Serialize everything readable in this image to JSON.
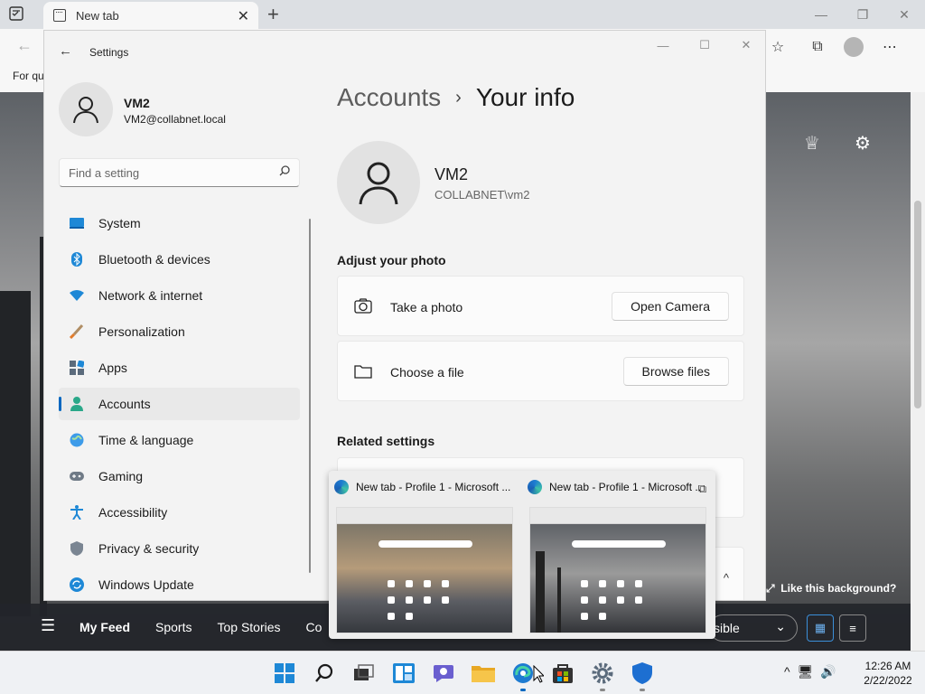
{
  "browser": {
    "tab_title": "New tab",
    "favbar_text": "For qu",
    "page": {
      "feed_items": [
        "My Feed",
        "Sports",
        "Top Stories",
        "Co"
      ],
      "visible_label": "sible",
      "like_background": "Like this background?"
    }
  },
  "settings": {
    "window_title": "Settings",
    "user": {
      "name": "VM2",
      "email": "VM2@collabnet.local"
    },
    "search_placeholder": "Find a setting",
    "nav": [
      {
        "label": "System",
        "icon": "system-icon"
      },
      {
        "label": "Bluetooth & devices",
        "icon": "bluetooth-icon"
      },
      {
        "label": "Network & internet",
        "icon": "network-icon"
      },
      {
        "label": "Personalization",
        "icon": "brush-icon"
      },
      {
        "label": "Apps",
        "icon": "apps-icon"
      },
      {
        "label": "Accounts",
        "icon": "accounts-icon",
        "selected": true
      },
      {
        "label": "Time & language",
        "icon": "globe-icon"
      },
      {
        "label": "Gaming",
        "icon": "gamepad-icon"
      },
      {
        "label": "Accessibility",
        "icon": "accessibility-icon"
      },
      {
        "label": "Privacy & security",
        "icon": "shield-icon"
      },
      {
        "label": "Windows Update",
        "icon": "update-icon"
      }
    ],
    "breadcrumb": {
      "parent": "Accounts",
      "separator": "›",
      "current": "Your info"
    },
    "profile": {
      "name": "VM2",
      "account": "COLLABNET\\vm2"
    },
    "adjust_photo": {
      "heading": "Adjust your photo",
      "take_photo": {
        "label": "Take a photo",
        "button": "Open Camera"
      },
      "choose_file": {
        "label": "Choose a file",
        "button": "Browse files"
      }
    },
    "related_settings": {
      "heading": "Related settings"
    }
  },
  "preview": {
    "items": [
      {
        "title": "New tab - Profile 1 - Microsoft ..."
      },
      {
        "title": "New tab - Profile 1 - Microsoft ..."
      }
    ]
  },
  "taskbar": {
    "time": "12:26 AM",
    "date": "2/22/2022"
  },
  "colors": {
    "accent": "#0067c0",
    "settings_bg": "#f3f3f3",
    "taskbar_bg": "#eff1f4"
  }
}
